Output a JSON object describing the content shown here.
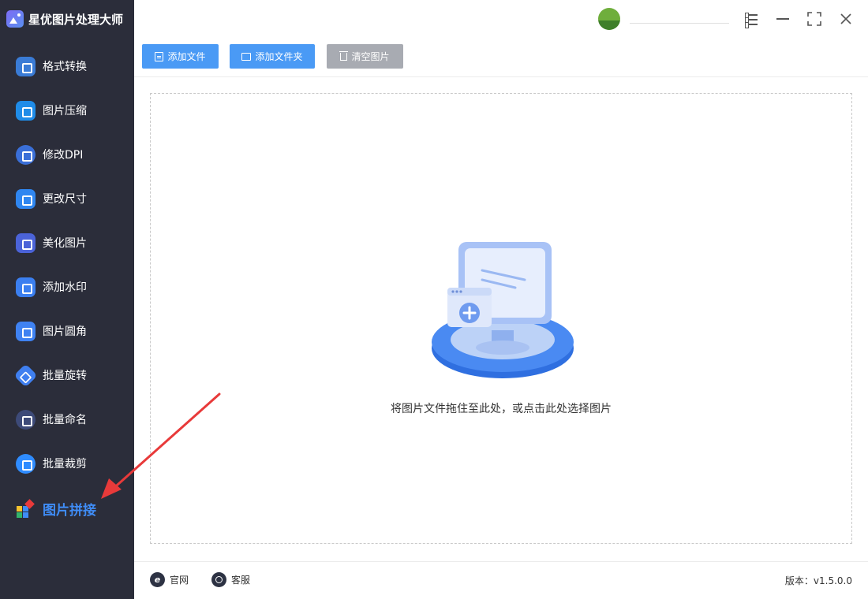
{
  "app": {
    "title": "星优图片处理大师"
  },
  "sidebar": {
    "items": [
      {
        "label": "格式转换",
        "icon": "image-convert-icon",
        "color": "#3a7bd5"
      },
      {
        "label": "图片压缩",
        "icon": "image-compress-icon",
        "color": "#1f8ce8"
      },
      {
        "label": "修改DPI",
        "icon": "dpi-icon",
        "color": "#3a6fd8"
      },
      {
        "label": "更改尺寸",
        "icon": "resize-icon",
        "color": "#2f86f0"
      },
      {
        "label": "美化图片",
        "icon": "beautify-icon",
        "color": "#4b63d8"
      },
      {
        "label": "添加水印",
        "icon": "watermark-icon",
        "color": "#3b7ff0"
      },
      {
        "label": "图片圆角",
        "icon": "rounded-corner-icon",
        "color": "#3f82f2"
      },
      {
        "label": "批量旋转",
        "icon": "rotate-icon",
        "color": "#3f7ff0"
      },
      {
        "label": "批量命名",
        "icon": "rename-icon",
        "color": "#3d4a78"
      },
      {
        "label": "批量裁剪",
        "icon": "crop-icon",
        "color": "#2f8cff"
      },
      {
        "label": "图片拼接",
        "icon": "stitch-icon",
        "color": "#3f8cf6",
        "active": true
      }
    ]
  },
  "toolbar": {
    "add_file": "添加文件",
    "add_folder": "添加文件夹",
    "clear": "清空图片"
  },
  "main": {
    "drop_hint": "将图片文件拖住至此处，或点击此处选择图片"
  },
  "footer": {
    "website": "官网",
    "support": "客服",
    "version": "版本：v1.5.0.0"
  },
  "colors": {
    "sidebar_bg": "#2b2d3a",
    "accent": "#4a9af5",
    "active": "#3f8cf6",
    "disabled": "#a8abb2",
    "annotation": "#e83a3a"
  }
}
